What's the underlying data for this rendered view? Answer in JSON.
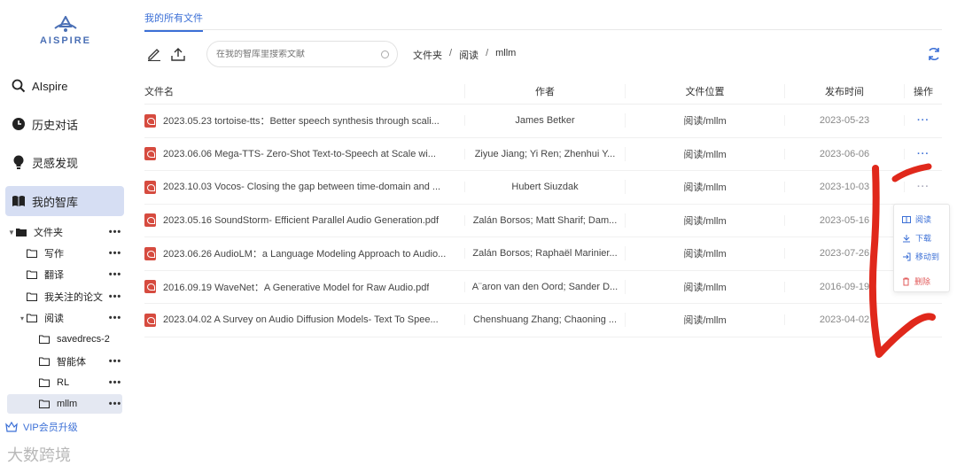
{
  "sidebar": {
    "logo_text": "AISPIRE",
    "nav": [
      {
        "label": "AIspire",
        "icon": "search-icon"
      },
      {
        "label": "历史对话",
        "icon": "clock-icon"
      },
      {
        "label": "灵感发现",
        "icon": "lightbulb-icon"
      },
      {
        "label": "我的智库",
        "icon": "book-icon"
      }
    ],
    "tree": [
      {
        "label": "文件夹",
        "level": 0,
        "expanded": true
      },
      {
        "label": "写作",
        "level": 1
      },
      {
        "label": "翻译",
        "level": 1
      },
      {
        "label": "我关注的论文",
        "level": 1
      },
      {
        "label": "阅读",
        "level": 1,
        "expanded": true
      },
      {
        "label": "savedrecs-2",
        "level": 2
      },
      {
        "label": "智能体",
        "level": 2
      },
      {
        "label": "RL",
        "level": 2
      },
      {
        "label": "mllm",
        "level": 2,
        "active": true
      }
    ],
    "more_label": "•••",
    "vip_label": "VIP会员升级",
    "watermark": "大数跨境"
  },
  "main": {
    "tab_label": "我的所有文件",
    "search_placeholder": "在我的智库里搜索文献",
    "breadcrumb": [
      "文件夹",
      "阅读",
      "mllm"
    ],
    "breadcrumb_sep": "/",
    "columns": [
      "文件名",
      "作者",
      "文件位置",
      "发布时间",
      "操作"
    ],
    "rows": [
      {
        "name": "2023.05.23 tortoise-tts：Better speech synthesis through scali...",
        "author": "James Betker",
        "location": "阅读/mllm",
        "date": "2023-05-23"
      },
      {
        "name": "2023.06.06 Mega-TTS- Zero-Shot Text-to-Speech at Scale wi...",
        "author": "Ziyue Jiang; Yi Ren; Zhenhui Y...",
        "location": "阅读/mllm",
        "date": "2023-06-06"
      },
      {
        "name": "2023.10.03 Vocos- Closing the gap between time-domain and ...",
        "author": "Hubert Siuzdak",
        "location": "阅读/mllm",
        "date": "2023-10-03"
      },
      {
        "name": "2023.05.16 SoundStorm- Efficient Parallel Audio Generation.pdf",
        "author": "Zalán Borsos; Matt Sharif; Dam...",
        "location": "阅读/mllm",
        "date": "2023-05-16"
      },
      {
        "name": "2023.06.26 AudioLM：a Language Modeling Approach to Audio...",
        "author": "Zalán Borsos; Raphaël Marinier...",
        "location": "阅读/mllm",
        "date": "2023-07-26"
      },
      {
        "name": "2016.09.19 WaveNet：A Generative Model for Raw Audio.pdf",
        "author": "A¨aron van den Oord; Sander D...",
        "location": "阅读/mllm",
        "date": "2016-09-19"
      },
      {
        "name": "2023.04.02 A Survey on Audio Diffusion Models- Text To Spee...",
        "author": "Chenshuang Zhang; Chaoning ...",
        "location": "阅读/mllm",
        "date": "2023-04-02"
      }
    ],
    "action_label": "···",
    "menu": [
      {
        "label": "阅读",
        "icon": "read-icon"
      },
      {
        "label": "下载",
        "icon": "download-icon"
      },
      {
        "label": "移动到",
        "icon": "move-icon"
      },
      {
        "label": "删除",
        "icon": "trash-icon"
      }
    ]
  },
  "colors": {
    "accent": "#3b6fd6",
    "active_nav": "#d6def3",
    "pdf": "#d64b3f",
    "annotation": "#e0281b",
    "danger": "#e25b5b"
  }
}
